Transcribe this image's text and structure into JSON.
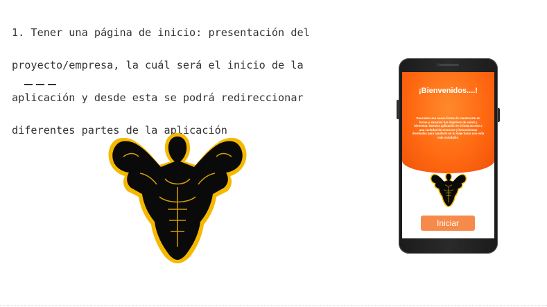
{
  "description": "1. Tener una página de inicio: presentación del proyecto/empresa, la cuál será el inicio de la aplicación y desde esta se podrá redireccionar diferentes partes de la aplicación",
  "description_lines": [
    "1. Tener una página de inicio: presentación del",
    "proyecto/empresa, la cuál será el inicio de la",
    "aplicación y desde esta se podrá redireccionar",
    "diferentes partes de la aplicación"
  ],
  "logo": {
    "icon": "bodybuilder-logo-icon",
    "colors": {
      "fill": "#000000",
      "outline": "#f5b800"
    }
  },
  "phone": {
    "screen": {
      "title": "¡Bienvenidos....!",
      "body": "Descubre una nueva forma de mantenerte en forma y alcanzar tus objetivos de salud y bienestar. Nuestra aplicación te brinda acceso a una variedad de recursos y herramientas diseñadas para ayudarte en tu viaje hacia una vida más saludable.",
      "start_button": "Iniciar",
      "colors": {
        "hero": "#ff6a12",
        "button": "#f58a4a"
      }
    }
  }
}
